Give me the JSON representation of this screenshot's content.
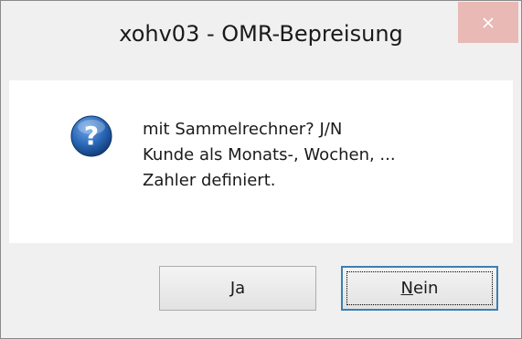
{
  "window": {
    "title": "xohv03 - OMR-Bepreisung",
    "close_glyph": "×"
  },
  "message": {
    "icon": "question-icon",
    "lines": [
      "mit Sammelrechner? J/N",
      "Kunde als Monats-, Wochen, ...",
      "Zahler definiert."
    ]
  },
  "buttons": {
    "yes": {
      "accel": "J",
      "rest": "a"
    },
    "no": {
      "accel": "N",
      "rest": "ein"
    }
  },
  "colors": {
    "close_button_bg": "#e8b9b5",
    "icon_blue": "#1f5ea8",
    "focus_border": "#3c7fb1"
  }
}
